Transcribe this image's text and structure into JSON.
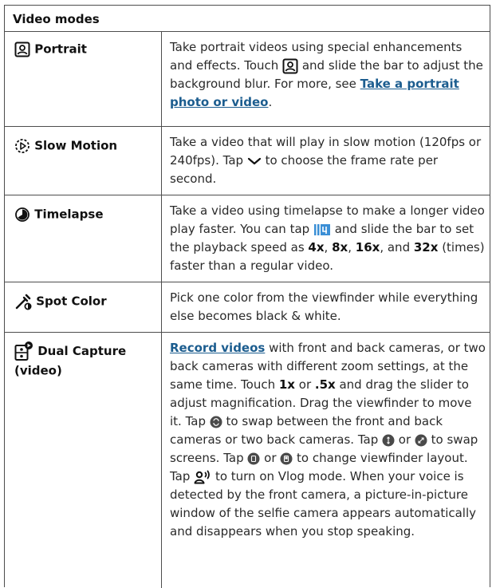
{
  "table": {
    "title": "Video modes",
    "rows": [
      {
        "mode": "Portrait",
        "icon": "portrait-icon",
        "desc": {
          "t1": "Take portrait videos using special enhancements and effects. Touch ",
          "t2": " and slide the bar to adjust the background blur. For more, see ",
          "link": "Take a portrait photo or video",
          "t3": "."
        }
      },
      {
        "mode": "Slow Motion",
        "icon": "slow-motion-icon",
        "desc": {
          "t1": "Take a video that will play in slow motion (120fps or 240fps). Tap ",
          "t2": " to choose the frame rate per second."
        }
      },
      {
        "mode": "Timelapse",
        "icon": "timelapse-icon",
        "desc": {
          "t1": "Take a video using timelapse to make a longer video play faster. You can tap ",
          "t2": " and slide the bar to set the playback speed as ",
          "s1": "4x",
          "c1": ", ",
          "s2": "8x",
          "c2": ", ",
          "s3": "16x",
          "c3": ", and ",
          "s4": "32x",
          "t3": " (times) faster than a regular video."
        }
      },
      {
        "mode": "Spot Color",
        "icon": "spot-color-icon",
        "desc": {
          "t1": "Pick one color from the viewfinder while everything else becomes black & white."
        }
      },
      {
        "mode": "Dual Capture (video)",
        "icon": "dual-capture-icon",
        "desc": {
          "link": "Record videos",
          "t1": " with front and back cameras, or two back cameras with different zoom settings, at the same time. Touch ",
          "b1": "1x",
          "t2": " or ",
          "b2": ".5x",
          "t3": " and drag the slider to adjust magnification. Drag the viewfinder to move it. Tap ",
          "t4": " to swap between the front and back cameras or two back cameras. Tap ",
          "t5": " or ",
          "t6": " to swap screens. Tap ",
          "t7": " or ",
          "t8": " to change viewfinder layout. Tap ",
          "t9": " to turn on Vlog mode. When your voice is detected by the front camera, a picture-in-picture window of the selfie camera appears automatically and disappears when you stop speaking."
        }
      }
    ]
  }
}
